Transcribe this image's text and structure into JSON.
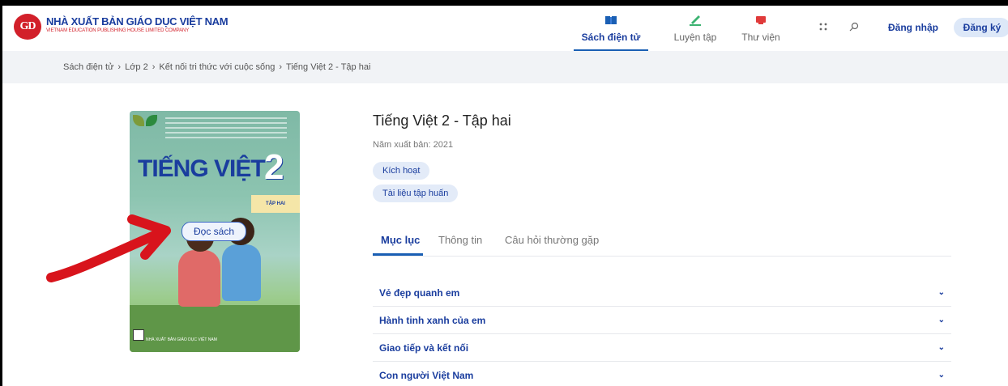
{
  "logo": {
    "mark": "GD",
    "title": "NHÀ XUẤT BẢN GIÁO DỤC VIỆT NAM",
    "subtitle": "VIETNAM EDUCATION PUBLISHING HOUSE LIMITED COMPANY"
  },
  "nav": [
    {
      "label": "Sách điện tử",
      "icon": "book-icon",
      "active": true
    },
    {
      "label": "Luyện tập",
      "icon": "pencil-icon",
      "active": false
    },
    {
      "label": "Thư viện",
      "icon": "library-icon",
      "active": false
    }
  ],
  "header": {
    "login": "Đăng nhập",
    "register": "Đăng ký",
    "icons": [
      "apps-icon",
      "search-icon"
    ]
  },
  "breadcrumb": [
    "Sách điện tử",
    "Lớp 2",
    "Kết nối tri thức với cuộc sống",
    "Tiếng Việt 2 - Tập hai"
  ],
  "cover": {
    "title": "TIẾNG VIỆT",
    "number": "2",
    "volume": "TẬP HAI",
    "publisher": "NHÀ XUẤT BẢN GIÁO DỤC VIỆT NAM",
    "read_button": "Đọc sách"
  },
  "book": {
    "title": "Tiếng Việt 2 - Tập hai",
    "year": "Năm xuất bản: 2021",
    "activate": "Kích hoạt",
    "training_docs": "Tài liệu tập huấn"
  },
  "tabs": [
    {
      "label": "Mục lục",
      "active": true
    },
    {
      "label": "Thông tin",
      "active": false
    },
    {
      "label": "Câu hỏi thường gặp",
      "active": false
    }
  ],
  "toc": [
    "Vẻ đẹp quanh em",
    "Hành tinh xanh của em",
    "Giao tiếp và kết nối",
    "Con người Việt Nam"
  ],
  "colors": {
    "brand_blue": "#1a3d9e",
    "brand_red": "#d2202a",
    "annotation_arrow": "#d8141c"
  }
}
